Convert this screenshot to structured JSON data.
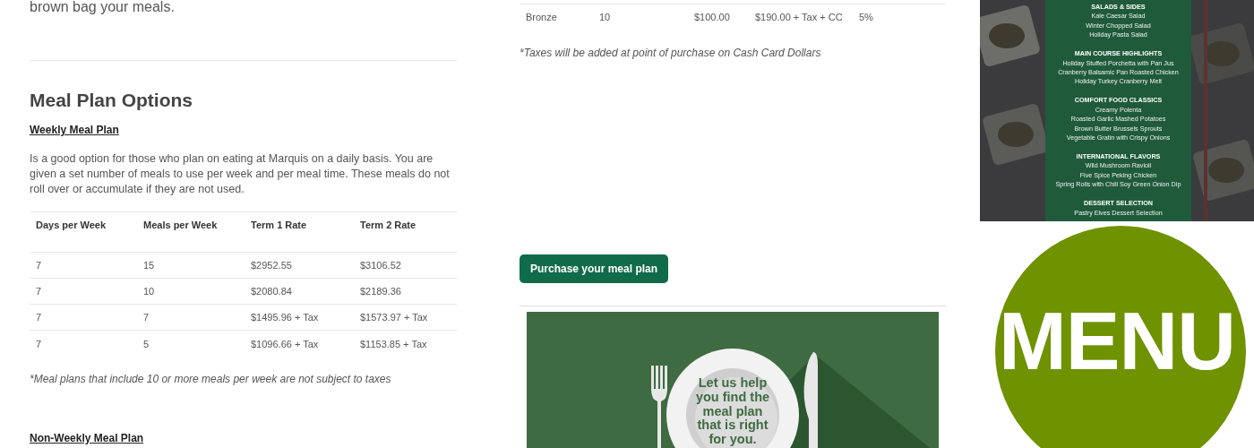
{
  "intro": {
    "text": "brown bag your meals."
  },
  "weekly": {
    "heading": "Meal Plan Options",
    "link": "Weekly Meal Plan",
    "description": "Is a good option for those who plan on eating at Marquis on a daily basis. You are given a set number of meals to use per week and per meal time. These meals do not roll over or accumulate if they are not used.",
    "table": {
      "columns": [
        "Days per Week",
        "Meals per Week",
        "Term 1 Rate",
        "Term 2 Rate"
      ],
      "rows": [
        [
          "7",
          "15",
          "$2952.55",
          "$3106.52"
        ],
        [
          "7",
          "10",
          "$2080.84",
          "$2189.36"
        ],
        [
          "7",
          "7",
          "$1495.96 + Tax",
          "$1573.97 + Tax"
        ],
        [
          "7",
          "5",
          "$1096.66 + Tax",
          "$1153.85 + Tax"
        ]
      ]
    },
    "note": "*Meal plans that include 10 or more meals per week are not subject to taxes"
  },
  "non_weekly": {
    "link": "Non-Weekly Meal Plan"
  },
  "cash_card_table": {
    "rows": [
      [
        "Bronze",
        "10",
        "$100.00",
        "$190.00 + Tax + CC",
        "5%"
      ]
    ],
    "note": "*Taxes will be added at point of purchase on Cash Card Dollars"
  },
  "purchase_button": {
    "label": "Purchase your meal plan"
  },
  "promo_graphic": {
    "caption_lines": [
      "Let us help",
      "you find the",
      "meal plan",
      "that is right",
      "for you."
    ]
  },
  "menu_flyer": {
    "sections": [
      {
        "heading": "SALADS & SIDES",
        "items": [
          "Kale Caesar Salad",
          "Winter Chopped Salad",
          "Holiday Pasta Salad"
        ]
      },
      {
        "heading": "MAIN COURSE HIGHLIGHTS",
        "items": [
          "Holiday Stuffed Porchetta with Pan Jus",
          "Cranberry Balsamic Pan Roasted Chicken",
          "Holiday Turkey Cranberry Melt"
        ]
      },
      {
        "heading": "COMFORT FOOD CLASSICS",
        "items": [
          "Creamy Polenta",
          "Roasted Garlic Mashed Potatoes",
          "Brown Butter Brussels Sprouts",
          "Vegetable Gratin with Crispy Onions"
        ]
      },
      {
        "heading": "INTERNATIONAL FLAVORS",
        "items": [
          "Wild Mushroom Ravioli",
          "Five Spice Peking Chicken",
          "Spring Rolls with Chili Soy Green Onion Dip"
        ]
      },
      {
        "heading": "DESSERT SELECTION",
        "items": [
          "Pastry Elves Dessert Selection"
        ]
      }
    ]
  },
  "menu_badge": {
    "text": "MENU"
  }
}
